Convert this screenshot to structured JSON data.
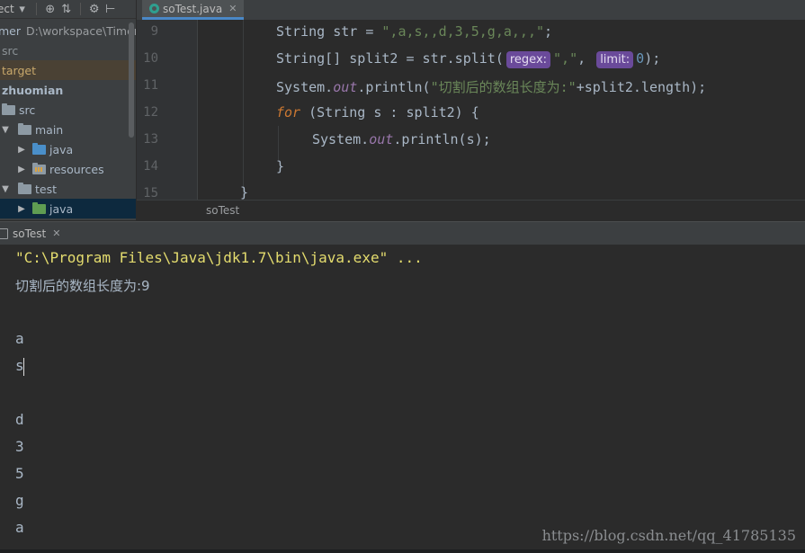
{
  "project_toolbar": {
    "label": "ect"
  },
  "tree": {
    "path_row": {
      "name": "mer",
      "path": "D:\\workspace\\Timer"
    },
    "items": [
      {
        "label": "src"
      },
      {
        "label": "target"
      },
      {
        "label": "zhuomian"
      },
      {
        "label": "src"
      },
      {
        "label": "main"
      },
      {
        "label": "java"
      },
      {
        "label": "resources"
      },
      {
        "label": "test"
      },
      {
        "label": "java"
      }
    ]
  },
  "editor": {
    "tab_label": "soTest.java",
    "breadcrumb": "soTest",
    "line_numbers": [
      "9",
      "10",
      "11",
      "12",
      "13",
      "14",
      "15"
    ],
    "lines": {
      "l9": {
        "a": "String str = ",
        "b": "\",a,s,,d,3,5,g,a,,,\"",
        "c": ";"
      },
      "l10": {
        "a": "String[] split2 = str.split(",
        "hint1": "regex:",
        "b": "\",\"",
        "c": ", ",
        "hint2": "limit:",
        "d": "0",
        "e": ");"
      },
      "l11": {
        "a": "System.",
        "b": "out",
        "c": ".println(",
        "d": "\"切割后的数组长度为:\"",
        "e": "+split2.length);"
      },
      "l12": {
        "a": "for",
        "b": " (String s : split2) {"
      },
      "l13": {
        "a": "System.",
        "b": "out",
        "c": ".println(s);"
      },
      "l14": {
        "a": "}"
      },
      "l15": {
        "a": "}"
      }
    }
  },
  "run": {
    "tab_label": "soTest",
    "console_lines": [
      "\"C:\\Program Files\\Java\\jdk1.7\\bin\\java.exe\" ...",
      "切割后的数组长度为:9",
      "",
      "a",
      "s",
      "",
      "d",
      "3",
      "5",
      "g",
      "a"
    ]
  },
  "watermark": "https://blog.csdn.net/qq_41785135",
  "colors": {
    "hint_bg": "#6a4a9a",
    "string_green": "#6a8759",
    "keyword_orange": "#cc7832",
    "field_purple": "#9876aa",
    "console_cmd_yellow": "#e4dc6e"
  }
}
